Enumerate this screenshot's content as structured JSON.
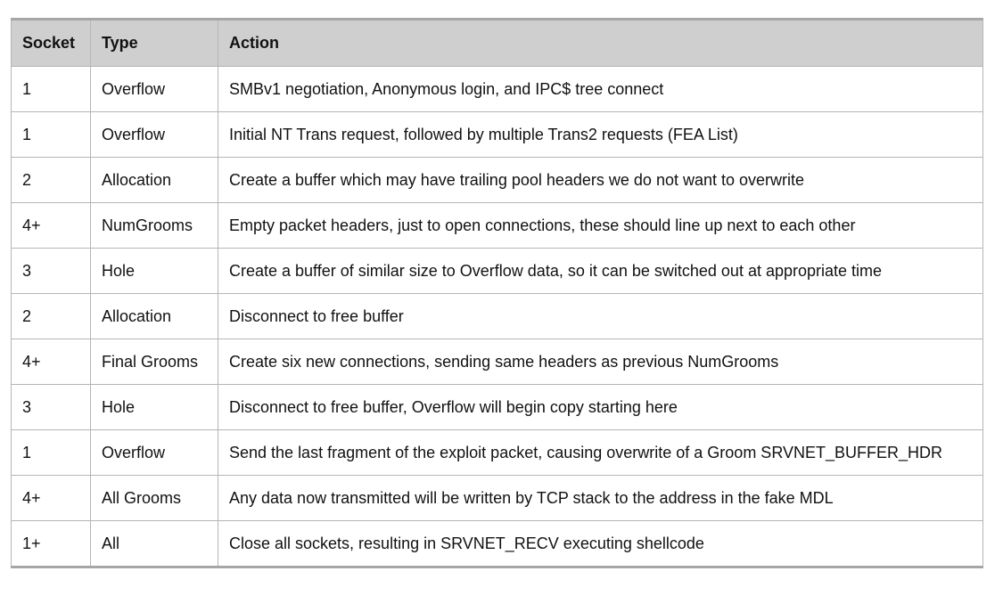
{
  "table": {
    "headers": [
      "Socket",
      "Type",
      "Action"
    ],
    "rows": [
      [
        "1",
        "Overflow",
        "SMBv1 negotiation, Anonymous login, and IPC$ tree connect"
      ],
      [
        "1",
        "Overflow",
        "Initial NT Trans request, followed by multiple Trans2 requests (FEA List)"
      ],
      [
        "2",
        "Allocation",
        "Create a buffer which may have trailing pool headers we do not want to overwrite"
      ],
      [
        "4+",
        "NumGrooms",
        "Empty packet headers, just to open connections, these should line up next to each other"
      ],
      [
        "3",
        "Hole",
        "Create a buffer of similar size to Overflow data, so it can be switched out at appropriate time"
      ],
      [
        "2",
        "Allocation",
        "Disconnect to free buffer"
      ],
      [
        "4+",
        "Final Grooms",
        "Create six new connections, sending same headers as previous NumGrooms"
      ],
      [
        "3",
        "Hole",
        "Disconnect to free buffer, Overflow will begin copy starting here"
      ],
      [
        "1",
        "Overflow",
        "Send the last fragment of the exploit packet, causing overwrite of a Groom SRVNET_BUFFER_HDR"
      ],
      [
        "4+",
        "All Grooms",
        "Any data now transmitted will be written by TCP stack to the address in the fake MDL"
      ],
      [
        "1+",
        "All",
        "Close all sockets, resulting in SRVNET_RECV executing shellcode"
      ]
    ]
  }
}
